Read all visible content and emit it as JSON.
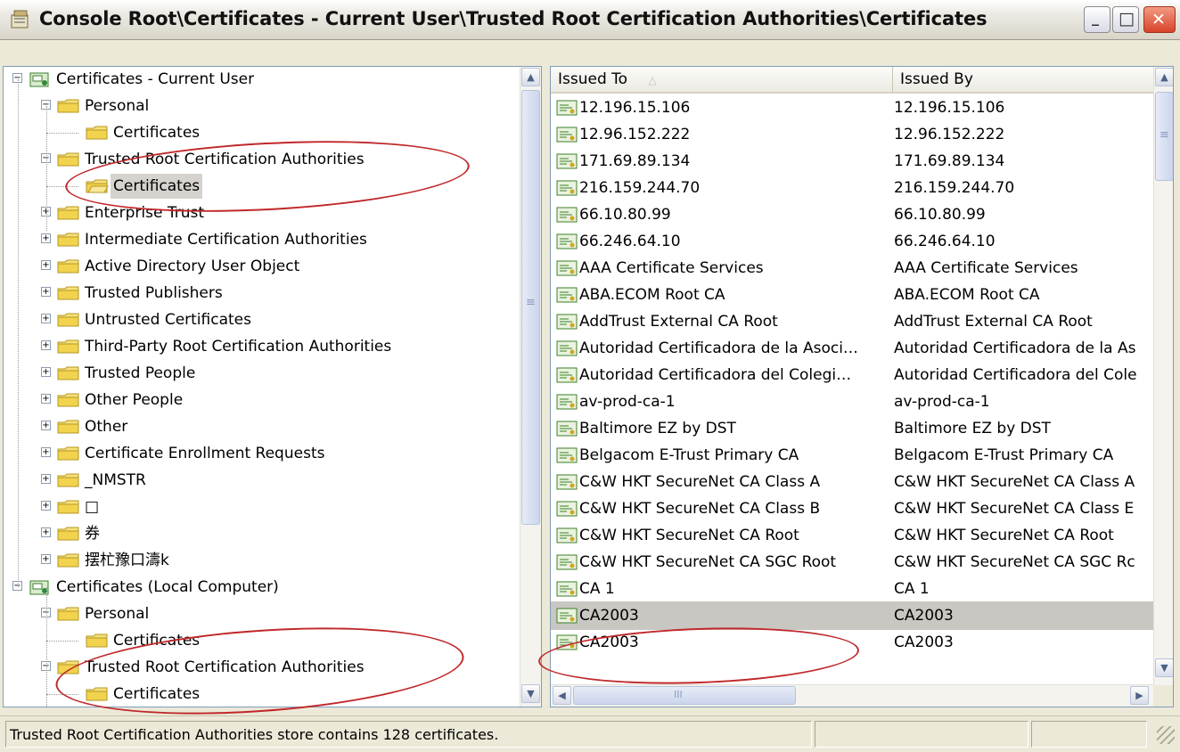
{
  "window": {
    "title": "Console Root\\Certificates - Current User\\Trusted Root Certification Authorities\\Certificates",
    "min_glyph": "_",
    "max_glyph": "□",
    "close_glyph": "✕"
  },
  "tree": {
    "nodes": [
      {
        "label": "Certificates - Current User",
        "level": 0,
        "expander": "−",
        "icon": "cert-store-icon"
      },
      {
        "label": "Personal",
        "level": 1,
        "expander": "−",
        "icon": "folder-icon"
      },
      {
        "label": "Certificates",
        "level": 2,
        "expander": "",
        "icon": "folder-icon"
      },
      {
        "label": "Trusted Root Certification Authorities",
        "level": 1,
        "expander": "−",
        "icon": "folder-icon"
      },
      {
        "label": "Certificates",
        "level": 2,
        "expander": "",
        "icon": "folder-open-icon",
        "selected": true
      },
      {
        "label": "Enterprise Trust",
        "level": 1,
        "expander": "+",
        "icon": "folder-icon"
      },
      {
        "label": "Intermediate Certification Authorities",
        "level": 1,
        "expander": "+",
        "icon": "folder-icon"
      },
      {
        "label": "Active Directory User Object",
        "level": 1,
        "expander": "+",
        "icon": "folder-icon"
      },
      {
        "label": "Trusted Publishers",
        "level": 1,
        "expander": "+",
        "icon": "folder-icon"
      },
      {
        "label": "Untrusted Certificates",
        "level": 1,
        "expander": "+",
        "icon": "folder-icon"
      },
      {
        "label": "Third-Party Root Certification Authorities",
        "level": 1,
        "expander": "+",
        "icon": "folder-icon"
      },
      {
        "label": "Trusted People",
        "level": 1,
        "expander": "+",
        "icon": "folder-icon"
      },
      {
        "label": "Other People",
        "level": 1,
        "expander": "+",
        "icon": "folder-icon"
      },
      {
        "label": "Other",
        "level": 1,
        "expander": "+",
        "icon": "folder-icon"
      },
      {
        "label": "Certificate Enrollment Requests",
        "level": 1,
        "expander": "+",
        "icon": "folder-icon"
      },
      {
        "label": "_NMSTR",
        "level": 1,
        "expander": "+",
        "icon": "folder-icon"
      },
      {
        "label": "□",
        "level": 1,
        "expander": "+",
        "icon": "folder-icon"
      },
      {
        "label": "券",
        "level": 1,
        "expander": "+",
        "icon": "folder-icon"
      },
      {
        "label": "摆杧豫口濤k",
        "level": 1,
        "expander": "+",
        "icon": "folder-icon"
      },
      {
        "label": "Certificates (Local Computer)",
        "level": 0,
        "expander": "−",
        "icon": "cert-store-icon"
      },
      {
        "label": "Personal",
        "level": 1,
        "expander": "−",
        "icon": "folder-icon"
      },
      {
        "label": "Certificates",
        "level": 2,
        "expander": "",
        "icon": "folder-icon"
      },
      {
        "label": "Trusted Root Certification Authorities",
        "level": 1,
        "expander": "−",
        "icon": "folder-icon"
      },
      {
        "label": "Certificates",
        "level": 2,
        "expander": "",
        "icon": "folder-icon"
      }
    ]
  },
  "list": {
    "columns": [
      {
        "label": "Issued To",
        "sort_glyph": "△"
      },
      {
        "label": "Issued By",
        "sort_glyph": ""
      }
    ],
    "rows": [
      {
        "issued_to": "12.196.15.106",
        "issued_by": "12.196.15.106"
      },
      {
        "issued_to": "12.96.152.222",
        "issued_by": "12.96.152.222"
      },
      {
        "issued_to": "171.69.89.134",
        "issued_by": "171.69.89.134"
      },
      {
        "issued_to": "216.159.244.70",
        "issued_by": "216.159.244.70"
      },
      {
        "issued_to": "66.10.80.99",
        "issued_by": "66.10.80.99"
      },
      {
        "issued_to": "66.246.64.10",
        "issued_by": "66.246.64.10"
      },
      {
        "issued_to": "AAA Certificate Services",
        "issued_by": "AAA Certificate Services"
      },
      {
        "issued_to": "ABA.ECOM Root CA",
        "issued_by": "ABA.ECOM Root CA"
      },
      {
        "issued_to": "AddTrust External CA Root",
        "issued_by": "AddTrust External CA Root"
      },
      {
        "issued_to": "Autoridad Certificadora de la Asoci…",
        "issued_by": "Autoridad Certificadora de la As"
      },
      {
        "issued_to": "Autoridad Certificadora del Colegi…",
        "issued_by": "Autoridad Certificadora del Cole"
      },
      {
        "issued_to": "av-prod-ca-1",
        "issued_by": "av-prod-ca-1"
      },
      {
        "issued_to": "Baltimore EZ by DST",
        "issued_by": "Baltimore EZ by DST"
      },
      {
        "issued_to": "Belgacom E-Trust Primary CA",
        "issued_by": "Belgacom E-Trust Primary CA"
      },
      {
        "issued_to": "C&W HKT SecureNet CA Class A",
        "issued_by": "C&W HKT SecureNet CA Class A"
      },
      {
        "issued_to": "C&W HKT SecureNet CA Class B",
        "issued_by": "C&W HKT SecureNet CA Class E"
      },
      {
        "issued_to": "C&W HKT SecureNet CA Root",
        "issued_by": "C&W HKT SecureNet CA Root"
      },
      {
        "issued_to": "C&W HKT SecureNet CA SGC Root",
        "issued_by": "C&W HKT SecureNet CA SGC Rc"
      },
      {
        "issued_to": "CA 1",
        "issued_by": "CA 1"
      },
      {
        "issued_to": "CA2003",
        "issued_by": "CA2003",
        "selected": true
      },
      {
        "issued_to": "CA2003",
        "issued_by": "CA2003"
      }
    ]
  },
  "status": {
    "text": "Trusted Root Certification Authorities store contains 128 certificates."
  },
  "scroll": {
    "up": "▲",
    "down": "▼",
    "left": "◀",
    "right": "▶",
    "grip": "≡",
    "hgrip": "III"
  },
  "colors": {
    "annotation": "#c0282a",
    "selection": "#c8c7c2",
    "pane_border": "#7f9db9"
  }
}
